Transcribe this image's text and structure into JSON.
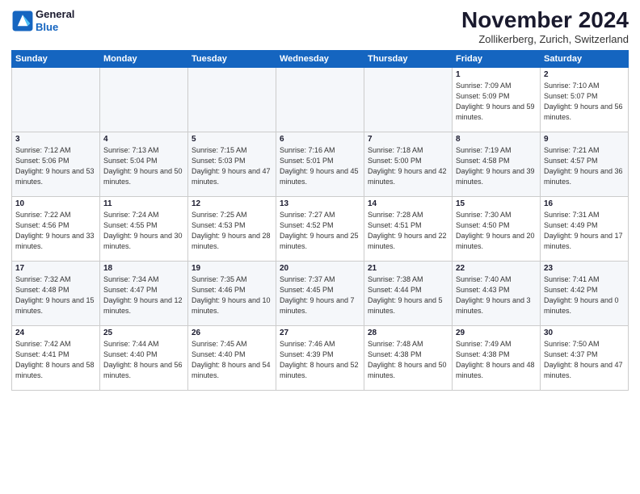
{
  "header": {
    "logo_line1": "General",
    "logo_line2": "Blue",
    "month": "November 2024",
    "location": "Zollikerberg, Zurich, Switzerland"
  },
  "weekdays": [
    "Sunday",
    "Monday",
    "Tuesday",
    "Wednesday",
    "Thursday",
    "Friday",
    "Saturday"
  ],
  "weeks": [
    [
      {
        "day": "",
        "info": ""
      },
      {
        "day": "",
        "info": ""
      },
      {
        "day": "",
        "info": ""
      },
      {
        "day": "",
        "info": ""
      },
      {
        "day": "",
        "info": ""
      },
      {
        "day": "1",
        "info": "Sunrise: 7:09 AM\nSunset: 5:09 PM\nDaylight: 9 hours and 59 minutes."
      },
      {
        "day": "2",
        "info": "Sunrise: 7:10 AM\nSunset: 5:07 PM\nDaylight: 9 hours and 56 minutes."
      }
    ],
    [
      {
        "day": "3",
        "info": "Sunrise: 7:12 AM\nSunset: 5:06 PM\nDaylight: 9 hours and 53 minutes."
      },
      {
        "day": "4",
        "info": "Sunrise: 7:13 AM\nSunset: 5:04 PM\nDaylight: 9 hours and 50 minutes."
      },
      {
        "day": "5",
        "info": "Sunrise: 7:15 AM\nSunset: 5:03 PM\nDaylight: 9 hours and 47 minutes."
      },
      {
        "day": "6",
        "info": "Sunrise: 7:16 AM\nSunset: 5:01 PM\nDaylight: 9 hours and 45 minutes."
      },
      {
        "day": "7",
        "info": "Sunrise: 7:18 AM\nSunset: 5:00 PM\nDaylight: 9 hours and 42 minutes."
      },
      {
        "day": "8",
        "info": "Sunrise: 7:19 AM\nSunset: 4:58 PM\nDaylight: 9 hours and 39 minutes."
      },
      {
        "day": "9",
        "info": "Sunrise: 7:21 AM\nSunset: 4:57 PM\nDaylight: 9 hours and 36 minutes."
      }
    ],
    [
      {
        "day": "10",
        "info": "Sunrise: 7:22 AM\nSunset: 4:56 PM\nDaylight: 9 hours and 33 minutes."
      },
      {
        "day": "11",
        "info": "Sunrise: 7:24 AM\nSunset: 4:55 PM\nDaylight: 9 hours and 30 minutes."
      },
      {
        "day": "12",
        "info": "Sunrise: 7:25 AM\nSunset: 4:53 PM\nDaylight: 9 hours and 28 minutes."
      },
      {
        "day": "13",
        "info": "Sunrise: 7:27 AM\nSunset: 4:52 PM\nDaylight: 9 hours and 25 minutes."
      },
      {
        "day": "14",
        "info": "Sunrise: 7:28 AM\nSunset: 4:51 PM\nDaylight: 9 hours and 22 minutes."
      },
      {
        "day": "15",
        "info": "Sunrise: 7:30 AM\nSunset: 4:50 PM\nDaylight: 9 hours and 20 minutes."
      },
      {
        "day": "16",
        "info": "Sunrise: 7:31 AM\nSunset: 4:49 PM\nDaylight: 9 hours and 17 minutes."
      }
    ],
    [
      {
        "day": "17",
        "info": "Sunrise: 7:32 AM\nSunset: 4:48 PM\nDaylight: 9 hours and 15 minutes."
      },
      {
        "day": "18",
        "info": "Sunrise: 7:34 AM\nSunset: 4:47 PM\nDaylight: 9 hours and 12 minutes."
      },
      {
        "day": "19",
        "info": "Sunrise: 7:35 AM\nSunset: 4:46 PM\nDaylight: 9 hours and 10 minutes."
      },
      {
        "day": "20",
        "info": "Sunrise: 7:37 AM\nSunset: 4:45 PM\nDaylight: 9 hours and 7 minutes."
      },
      {
        "day": "21",
        "info": "Sunrise: 7:38 AM\nSunset: 4:44 PM\nDaylight: 9 hours and 5 minutes."
      },
      {
        "day": "22",
        "info": "Sunrise: 7:40 AM\nSunset: 4:43 PM\nDaylight: 9 hours and 3 minutes."
      },
      {
        "day": "23",
        "info": "Sunrise: 7:41 AM\nSunset: 4:42 PM\nDaylight: 9 hours and 0 minutes."
      }
    ],
    [
      {
        "day": "24",
        "info": "Sunrise: 7:42 AM\nSunset: 4:41 PM\nDaylight: 8 hours and 58 minutes."
      },
      {
        "day": "25",
        "info": "Sunrise: 7:44 AM\nSunset: 4:40 PM\nDaylight: 8 hours and 56 minutes."
      },
      {
        "day": "26",
        "info": "Sunrise: 7:45 AM\nSunset: 4:40 PM\nDaylight: 8 hours and 54 minutes."
      },
      {
        "day": "27",
        "info": "Sunrise: 7:46 AM\nSunset: 4:39 PM\nDaylight: 8 hours and 52 minutes."
      },
      {
        "day": "28",
        "info": "Sunrise: 7:48 AM\nSunset: 4:38 PM\nDaylight: 8 hours and 50 minutes."
      },
      {
        "day": "29",
        "info": "Sunrise: 7:49 AM\nSunset: 4:38 PM\nDaylight: 8 hours and 48 minutes."
      },
      {
        "day": "30",
        "info": "Sunrise: 7:50 AM\nSunset: 4:37 PM\nDaylight: 8 hours and 47 minutes."
      }
    ]
  ]
}
